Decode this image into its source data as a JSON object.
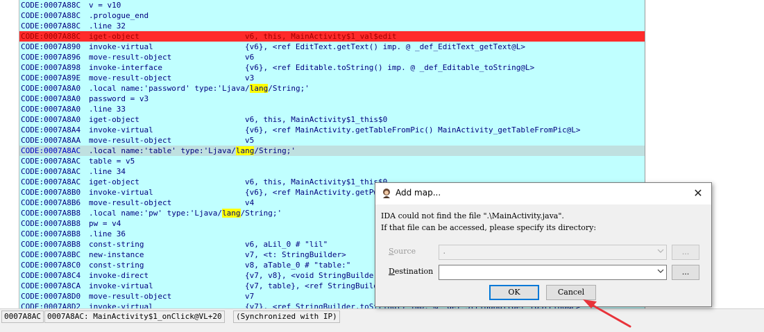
{
  "code_lines": [
    {
      "addr": "CODE:0007A88C",
      "mnem": "v = v10",
      "ops": ""
    },
    {
      "addr": "CODE:0007A88C",
      "mnem": ".prologue_end",
      "ops": ""
    },
    {
      "addr": "CODE:0007A88C",
      "mnem": ".line 32",
      "ops": ""
    },
    {
      "addr": "CODE:0007A88C",
      "mnem": "iget-object",
      "ops": "v6, this, MainActivity$1_val$edit",
      "hl": "red"
    },
    {
      "addr": "CODE:0007A890",
      "mnem": "invoke-virtual",
      "ops": "{v6}, <ref EditText.getText() imp. @ _def_EditText_getText@L>"
    },
    {
      "addr": "CODE:0007A896",
      "mnem": "move-result-object",
      "ops": "v6"
    },
    {
      "addr": "CODE:0007A898",
      "mnem": "invoke-interface",
      "ops": "{v6}, <ref Editable.toString() imp. @ _def_Editable_toString@L>"
    },
    {
      "addr": "CODE:0007A89E",
      "mnem": "move-result-object",
      "ops": "v3"
    },
    {
      "addr": "CODE:0007A8A0",
      "mnem": ".local name:'password' type:'Ljava/lang/String;'",
      "ops": ""
    },
    {
      "addr": "CODE:0007A8A0",
      "mnem": "password = v3",
      "ops": ""
    },
    {
      "addr": "CODE:0007A8A0",
      "mnem": ".line 33",
      "ops": ""
    },
    {
      "addr": "CODE:0007A8A0",
      "mnem": "iget-object",
      "ops": "v6, this, MainActivity$1_this$0"
    },
    {
      "addr": "CODE:0007A8A4",
      "mnem": "invoke-virtual",
      "ops": "{v6}, <ref MainActivity.getTableFromPic() MainActivity_getTableFromPic@L>"
    },
    {
      "addr": "CODE:0007A8AA",
      "mnem": "move-result-object",
      "ops": "v5"
    },
    {
      "addr": "CODE:0007A8AC",
      "mnem": ".local name:'table' type:'Ljava/lang/String;'",
      "ops": "",
      "hl": "cur"
    },
    {
      "addr": "CODE:0007A8AC",
      "mnem": "table = v5",
      "ops": ""
    },
    {
      "addr": "CODE:0007A8AC",
      "mnem": ".line 34",
      "ops": ""
    },
    {
      "addr": "CODE:0007A8AC",
      "mnem": "iget-object",
      "ops": "v6, this, MainActivity$1_this$0"
    },
    {
      "addr": "CODE:0007A8B0",
      "mnem": "invoke-virtual",
      "ops": "{v6}, <ref MainActivity.getPwdFromPic() MainActivity_getPwdFromPic@L>"
    },
    {
      "addr": "CODE:0007A8B6",
      "mnem": "move-result-object",
      "ops": "v4"
    },
    {
      "addr": "CODE:0007A8B8",
      "mnem": ".local name:'pw' type:'Ljava/lang/String;'",
      "ops": ""
    },
    {
      "addr": "CODE:0007A8B8",
      "mnem": "pw = v4",
      "ops": ""
    },
    {
      "addr": "CODE:0007A8B8",
      "mnem": ".line 36",
      "ops": ""
    },
    {
      "addr": "CODE:0007A8B8",
      "mnem": "const-string",
      "ops": "v6, aLil_0 # \"lil\""
    },
    {
      "addr": "CODE:0007A8BC",
      "mnem": "new-instance",
      "ops": "v7, <t: StringBuilder>"
    },
    {
      "addr": "CODE:0007A8C0",
      "mnem": "const-string",
      "ops": "v8, aTable_0 # \"table:\""
    },
    {
      "addr": "CODE:0007A8C4",
      "mnem": "invoke-direct",
      "ops": "{v7, v8}, <void StringBuilder.<init>(ref) imp. @ _def_StringBuilder__init_@VL>"
    },
    {
      "addr": "CODE:0007A8CA",
      "mnem": "invoke-virtual",
      "ops": "{v7, table}, <ref StringBuilder.append(ref) imp. @ _def_StringBuilder_append@LL>"
    },
    {
      "addr": "CODE:0007A8D0",
      "mnem": "move-result-object",
      "ops": "v7"
    },
    {
      "addr": "CODE:0007A8D2",
      "mnem": "invoke-virtual",
      "ops": "{v7}, <ref StringBuilder.toString() imp. @ _def_StringBuilder_toString@L>"
    }
  ],
  "highlight_word": "lang",
  "status": {
    "cell1": "0007A8AC",
    "cell2": "0007A8AC: MainActivity$1_onClick@VL+20",
    "cell3": "(Synchronized with IP)"
  },
  "dialog": {
    "title": "Add map...",
    "message_line1": "IDA could not find the file \".\\MainActivity.java\".",
    "message_line2": "If that file can be accessed, please specify its directory:",
    "source_label": "Source",
    "source_value": ".",
    "destination_label": "Destination",
    "destination_value": "",
    "browse_label": "...",
    "ok_label": "OK",
    "cancel_label": "Cancel",
    "close_glyph": "✕"
  },
  "colors": {
    "code_bg": "#c0ffff",
    "breakpoint_line": "#ff2b2b",
    "current_line": "#bfe0e0",
    "highlight": "#ffff00",
    "annotation_arrow": "#e8333a"
  },
  "icons": {
    "dialog_icon": "ida-app-icon",
    "combo_arrow": "chevron-down-icon",
    "annotation": "red-arrow-pointer"
  }
}
